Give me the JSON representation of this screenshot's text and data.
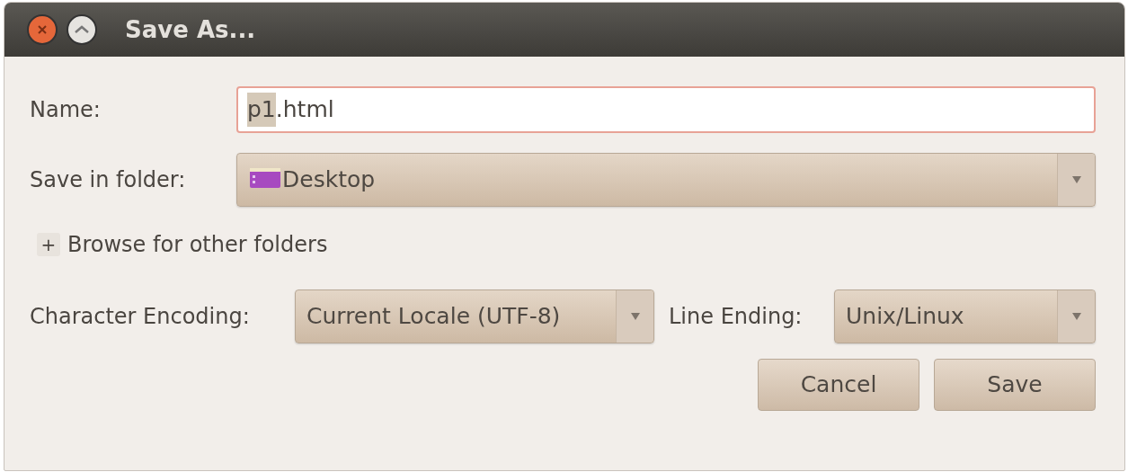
{
  "window": {
    "title": "Save As..."
  },
  "name_row": {
    "label": "Name:",
    "value_parts": [
      {
        "text": "p1",
        "selected": true
      },
      {
        "text": ".html",
        "selected": false
      }
    ]
  },
  "folder_row": {
    "label": "Save in folder:",
    "value": "Desktop"
  },
  "browse": {
    "expander": "+",
    "label": "Browse for other folders",
    "expanded": false
  },
  "encoding": {
    "label": "Character Encoding:",
    "value": "Current Locale (UTF-8)"
  },
  "line_ending": {
    "label": "Line Ending:",
    "value": "Unix/Linux"
  },
  "buttons": [
    "Cancel",
    "Save"
  ]
}
